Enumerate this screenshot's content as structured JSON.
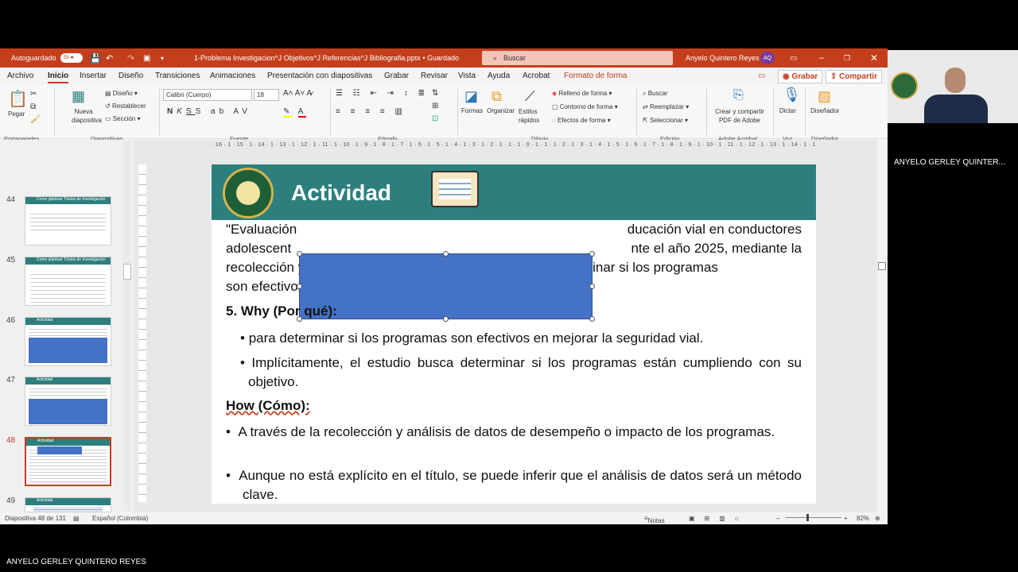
{
  "titlebar": {
    "autosave": "Autoguardado",
    "filename": "1-Problema Investigacion^J Objetivos^J Referencias^J Bibliografia.pptx • Guardado",
    "search_placeholder": "Buscar",
    "user": "Anyelo Quintero Reyes",
    "initials": "AQ"
  },
  "menu": [
    "Archivo",
    "Inicio",
    "Insertar",
    "Diseño",
    "Transiciones",
    "Animaciones",
    "Presentación con diapositivas",
    "Grabar",
    "Revisar",
    "Vista",
    "Ayuda",
    "Acrobat",
    "Formato de forma"
  ],
  "record_label": "Grabar",
  "share_label": "Compartir",
  "ribbon": {
    "paste": "Pegar",
    "new_slide": "Nueva diapositiva",
    "layout": "Diseño",
    "reset": "Restablecer",
    "section": "Sección",
    "font": "Calibri (Cuerpo)",
    "size": "18",
    "shapes": "Formas",
    "arrange": "Organizar",
    "quick_styles": "Estilos rápidos",
    "fill": "Relleno de forma",
    "outline": "Contorno de forma",
    "effects": "Efectos de forma",
    "find": "Buscar",
    "replace": "Reemplazar",
    "select": "Seleccionar",
    "create_pdf": "Crear y compartir PDF de Adobe",
    "dictate": "Dictar",
    "designer": "Diseñador",
    "groups": [
      "Portapapeles",
      "Diapositivas",
      "Fuente",
      "Párrafo",
      "Dibujo",
      "Edición",
      "Adobe Acrobat",
      "Voz",
      "Diseñador"
    ]
  },
  "ruler": "· 16 · 1 · 15 · 1 · 14 · 1 · 13 · 1 · 12 · 1 · 11 · 1 · 10 · 1 · 9 · 1 · 8 · 1 · 7 · 1 · 6 · 1 · 5 · 1 · 4 · 1 · 3 · 1 · 2 · 1 · 1 · 1 · 0 · 1 · 1 · 1 · 2 · 1 · 3 · 1 · 4 · 1 · 5 · 1 · 6 · 1 · 7 · 1 · 8 · 1 · 9 · 1 · 10 · 1 · 11 · 1 · 12 · 1 · 13 · 1 · 14 · 1 · 15 · 1 · 16 ·",
  "thumbs": [
    {
      "n": "44",
      "title": "Como plantear Títulos de Investigación"
    },
    {
      "n": "45",
      "title": "Como plantear Títulos de Investigación"
    },
    {
      "n": "46",
      "title": "Actividad"
    },
    {
      "n": "47",
      "title": "Actividad"
    },
    {
      "n": "48",
      "title": "Actividad"
    },
    {
      "n": "49",
      "title": "Actividad"
    }
  ],
  "slide": {
    "title": "Actividad",
    "p1a": "\"Evaluación",
    "p1b": "ducación vial en conductores",
    "p2a": "adolescent",
    "p2b": "nte el año 2025, mediante la",
    "p3": "recolección y análisis de datos sobre el impacto, para determinar si los programas",
    "p4": "son efectivos en mejorar la seguridad vial. “",
    "why": "5. Why (Por qué):",
    "b1": "para determinar si los programas son efectivos en mejorar la seguridad vial.",
    "b2": "Implícitamente, el estudio busca determinar si los programas están cumpliendo con su objetivo.",
    "how": "How (Cómo):",
    "b3": "A través de la recolección y análisis de datos de desempeño o impacto de los programas.",
    "b4": "Aunque no está explícito en el título, se puede inferir que el análisis de datos será un método clave."
  },
  "status": {
    "slide": "Diapositiva 48 de 131",
    "lang": "Español (Colombia)",
    "notes": "Notas",
    "zoom": "82%"
  },
  "participant": "ANYELO GERLEY QUINTER...",
  "bottom_name": "ANYELO GERLEY QUINTERO REYES",
  "colors": {
    "titlebar": "#c43e1c",
    "slide_header": "#2d7f7e",
    "shape": "#4472c4"
  }
}
